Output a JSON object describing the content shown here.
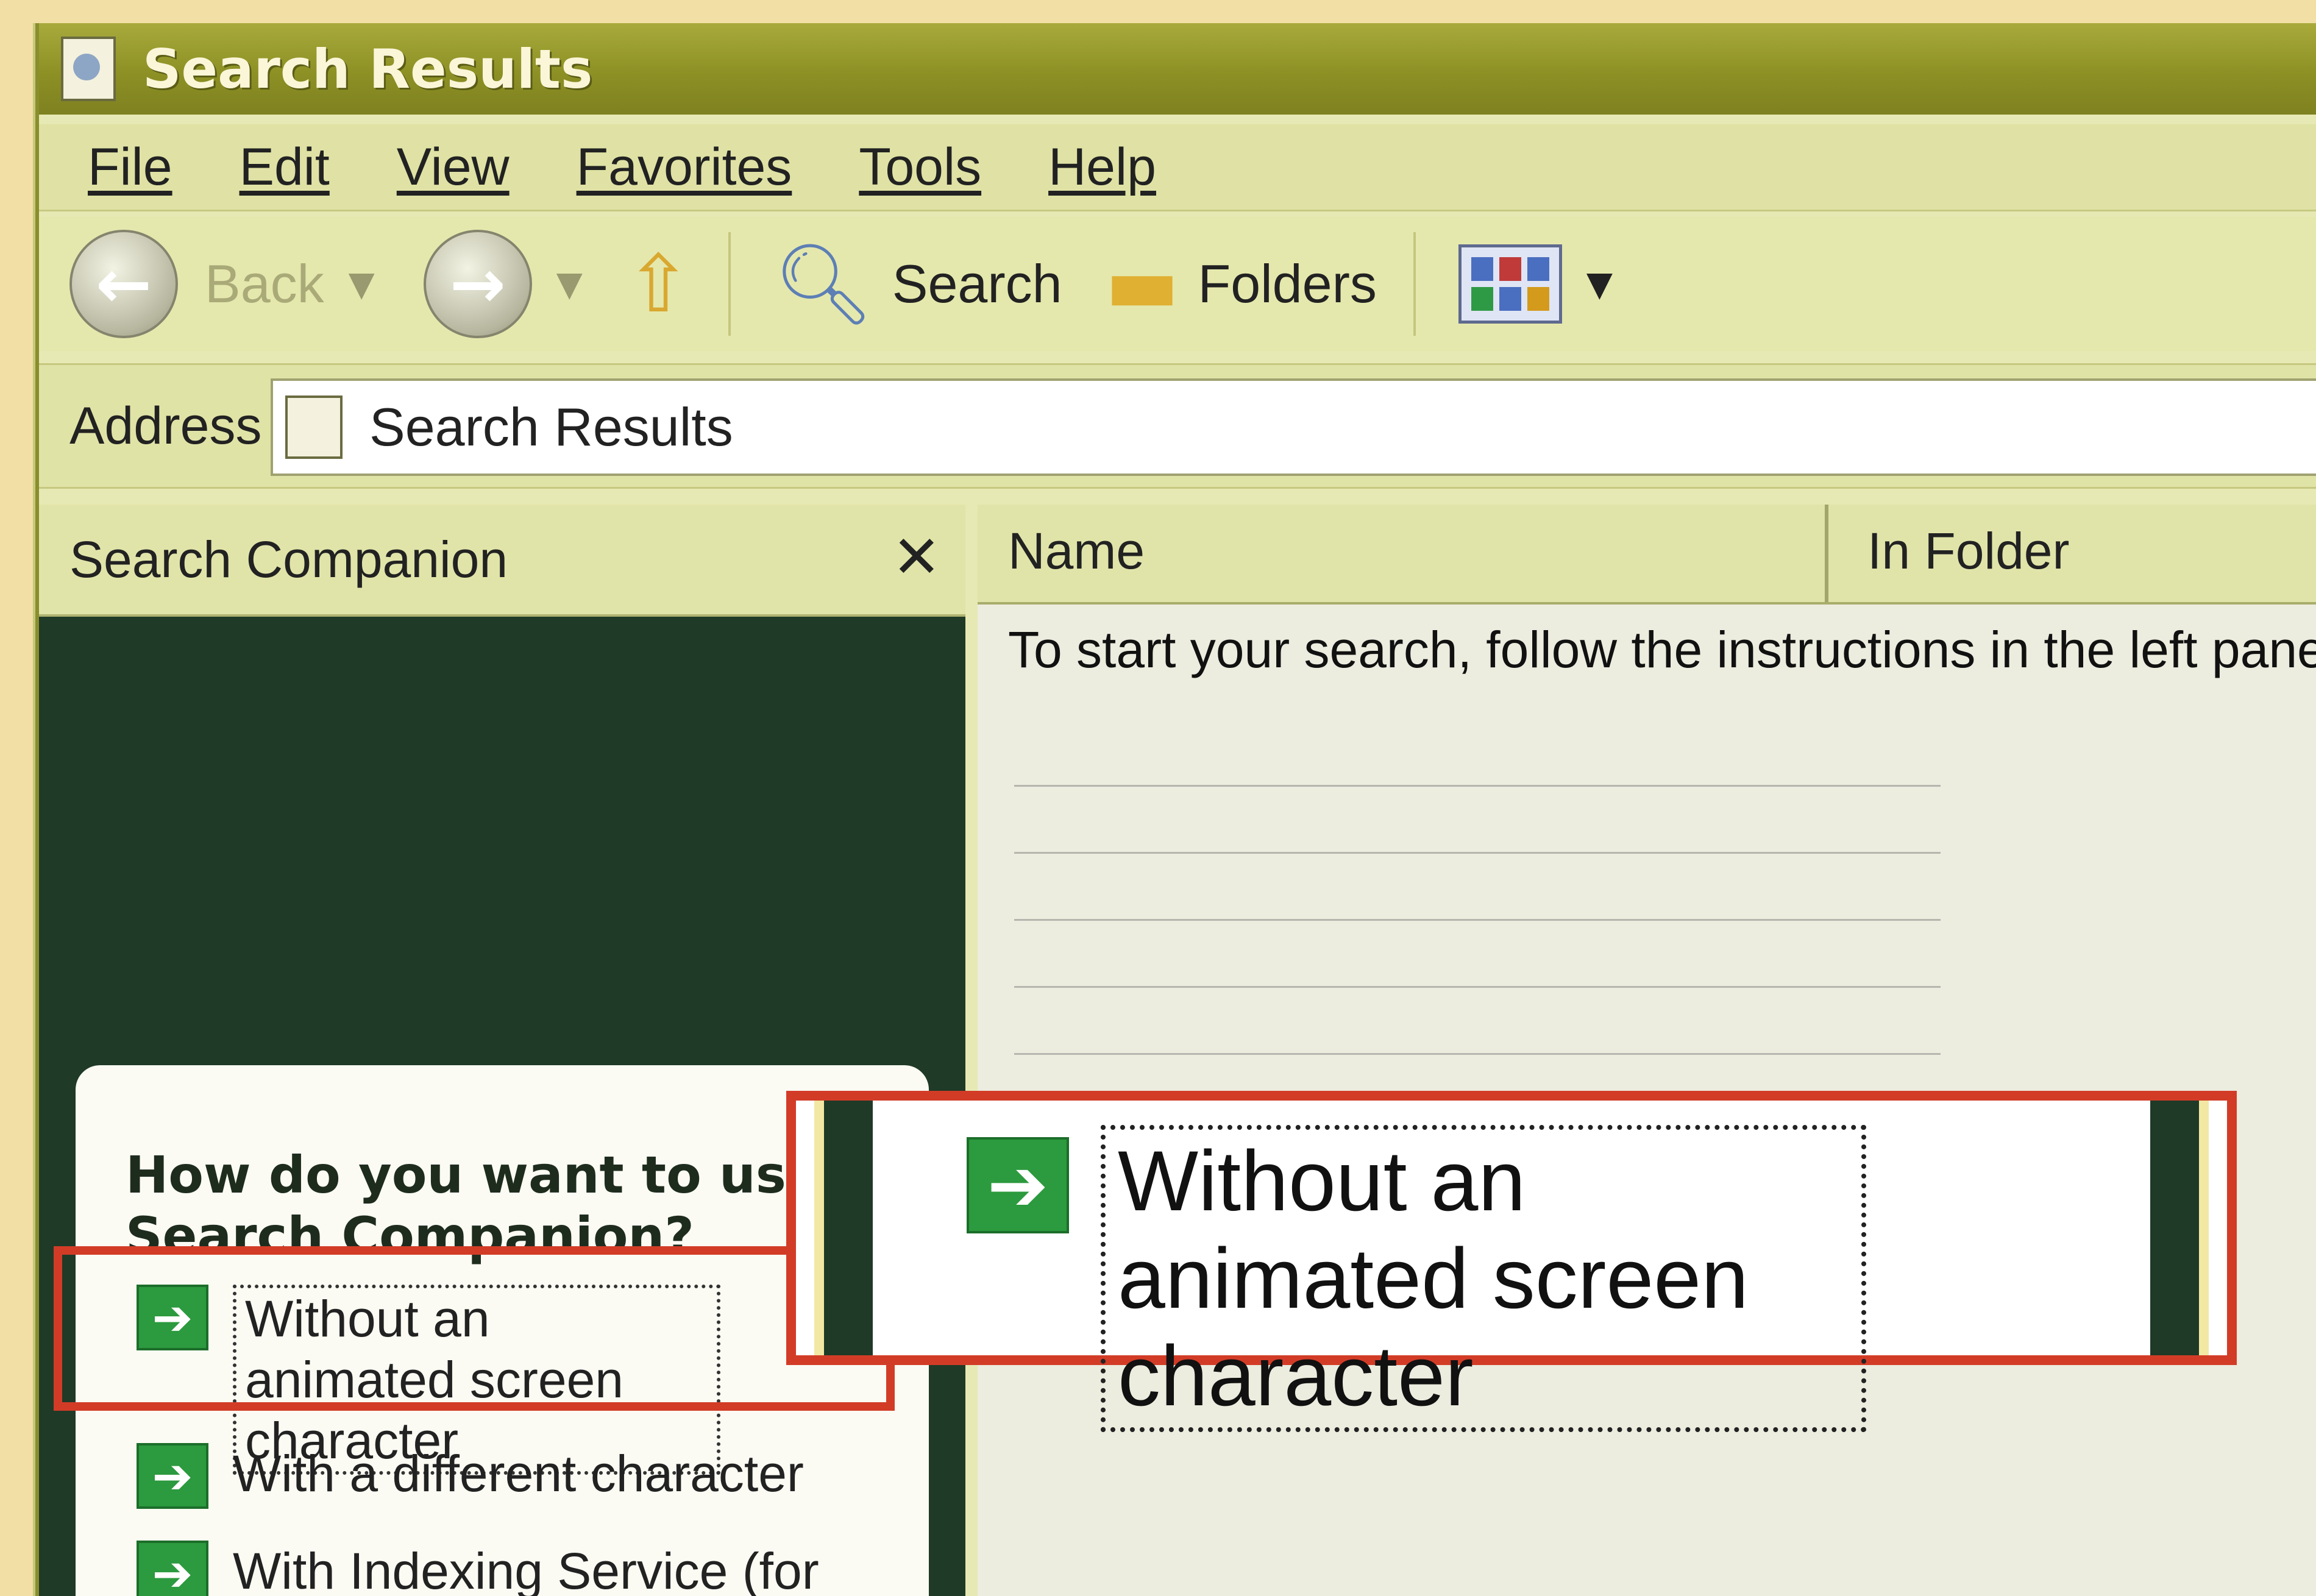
{
  "window": {
    "title": "Search Results"
  },
  "menu": [
    "File",
    "Edit",
    "View",
    "Favorites",
    "Tools",
    "Help"
  ],
  "toolbar": {
    "back_label": "Back",
    "search_label": "Search",
    "folders_label": "Folders"
  },
  "address": {
    "label": "Address",
    "value": "Search Results"
  },
  "search_companion": {
    "title": "Search Companion",
    "close": "✕",
    "question": "How do you want to use Search Companion?",
    "options": [
      "Without an animated screen character",
      "With a different character",
      "With Indexing Service (for"
    ]
  },
  "results": {
    "columns": [
      "Name",
      "In Folder"
    ],
    "message": "To start your search, follow the instructions in the left pane"
  },
  "callout": {
    "text": "Without an animated screen character"
  },
  "colors": {
    "highlight": "#d23c27",
    "accent": "#8d9024"
  }
}
